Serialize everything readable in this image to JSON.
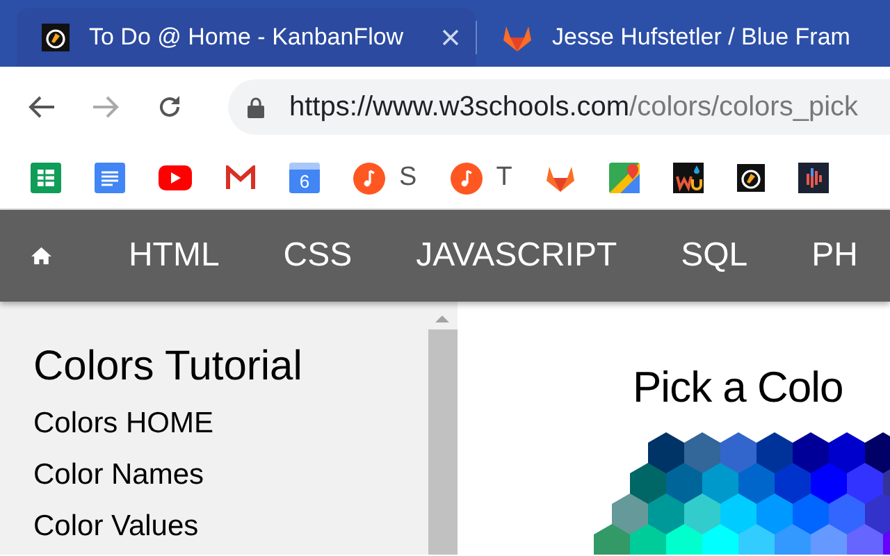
{
  "browser_tabs": [
    {
      "title": "To Do @ Home - KanbanFlow",
      "kind": "kanban",
      "selected": true
    },
    {
      "title": "Jesse Hufstetler / Blue Fram",
      "kind": "gitlab",
      "selected": false
    }
  ],
  "address_bar": {
    "origin": "https://www.w3schools.com",
    "path": "/colors/colors_pick"
  },
  "bookmarks": [
    {
      "kind": "sheets"
    },
    {
      "kind": "docs"
    },
    {
      "kind": "youtube"
    },
    {
      "kind": "gmail"
    },
    {
      "kind": "calendar",
      "label": "6"
    },
    {
      "kind": "music",
      "label": "S"
    },
    {
      "kind": "music",
      "label": "T"
    },
    {
      "kind": "gitlab"
    },
    {
      "kind": "maps"
    },
    {
      "kind": "wu"
    },
    {
      "kind": "kanban"
    },
    {
      "kind": "bars"
    }
  ],
  "nav": {
    "items": [
      "HTML",
      "CSS",
      "JAVASCRIPT",
      "SQL",
      "PH"
    ]
  },
  "sidebar": {
    "title": "Colors Tutorial",
    "items": [
      "Colors HOME",
      "Color Names",
      "Color Values"
    ]
  },
  "content": {
    "heading": "Pick a Colo"
  }
}
